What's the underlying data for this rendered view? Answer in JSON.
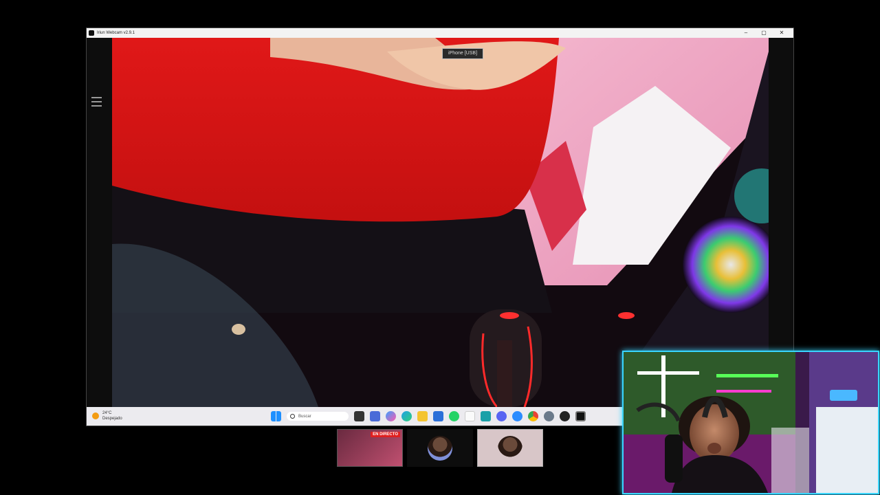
{
  "window": {
    "title": "Iriun Webcam v2.9.1",
    "controls": {
      "minimize": "–",
      "maximize": "▢",
      "close": "✕"
    },
    "device_select": {
      "value": "iPhone [USB]"
    }
  },
  "taskbar": {
    "weather": {
      "temp": "24°C",
      "condition": "Despejado"
    },
    "search_placeholder": "Buscar",
    "icons": [
      "windows-start",
      "search",
      "widgets",
      "file-manager",
      "copilot",
      "edge",
      "file-explorer",
      "store",
      "whatsapp",
      "notepad",
      "calculator",
      "discord",
      "media-player",
      "chrome",
      "settings",
      "obs",
      "iriun-webcam"
    ]
  },
  "stream_thumbnails": [
    {
      "badge": "EN DIRECTO"
    },
    {
      "badge": ""
    },
    {
      "badge": ""
    }
  ],
  "colors": {
    "accent_cyan": "#39d5ff",
    "accent_pink": "#ff3ccf",
    "live_red": "#e02020"
  }
}
